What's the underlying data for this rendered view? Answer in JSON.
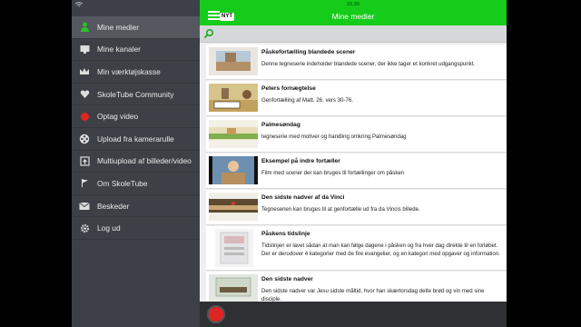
{
  "status": {
    "time": "10.39"
  },
  "sidebar": {
    "items": [
      {
        "label": "Mine medier",
        "icon": "person-icon"
      },
      {
        "label": "Mine kanaler",
        "icon": "monitor-icon"
      },
      {
        "label": "Min værktøjskasse",
        "icon": "crown-icon"
      },
      {
        "label": "SkoleTube Community",
        "icon": "heart-icon"
      },
      {
        "label": "Optag video",
        "icon": "record-icon"
      },
      {
        "label": "Upload fra kamerarulle",
        "icon": "film-reel-icon"
      },
      {
        "label": "Multiupload af billeder/video",
        "icon": "folder-upload-icon"
      },
      {
        "label": "Om SkoleTube",
        "icon": "flag-icon"
      },
      {
        "label": "Beskeder",
        "icon": "envelope-icon"
      },
      {
        "label": "Log ud",
        "icon": "gear-icon"
      }
    ]
  },
  "header": {
    "title": "Mine medier",
    "badge": "NYT"
  },
  "colors": {
    "accent": "#15cc1a",
    "sidebar": "#3d4046",
    "record": "#e02424"
  },
  "media": [
    {
      "title": "Påskefortælling blandede scener",
      "desc": "Denne tegneserie indeholder blandede scener, der ikke tager et konkret udgangspunkt."
    },
    {
      "title": "Peters fornægtelse",
      "desc": "Genfortælling af Matt. 26, vers 30-76."
    },
    {
      "title": "Palmesøndag",
      "desc": "tegneserie med motiver og handling omkring Palmesøndag"
    },
    {
      "title": "Eksempel på indre fortæller",
      "desc": "Film med scener der kan bruges til fortællinger om påsken"
    },
    {
      "title": "Den sidste nadver af da Vinci",
      "desc": "Tegneserien kan bruges til at genfortælle ud fra da Vincis billede."
    },
    {
      "title": "Påskens tidslinje",
      "desc": "Tidslinjen er lavet sådan at man kan følge dagene i påsken og fra hver dag direkte til en forløbet. Der er derudover 4 kategorier med de fire evangelier, og en kategori med opgaver og information."
    },
    {
      "title": "Den sidste nadver",
      "desc": "Den sidste nadver var Jesu sidste måltid, hvor han skærtorsdag delte brød og vin med sine disciple."
    }
  ]
}
